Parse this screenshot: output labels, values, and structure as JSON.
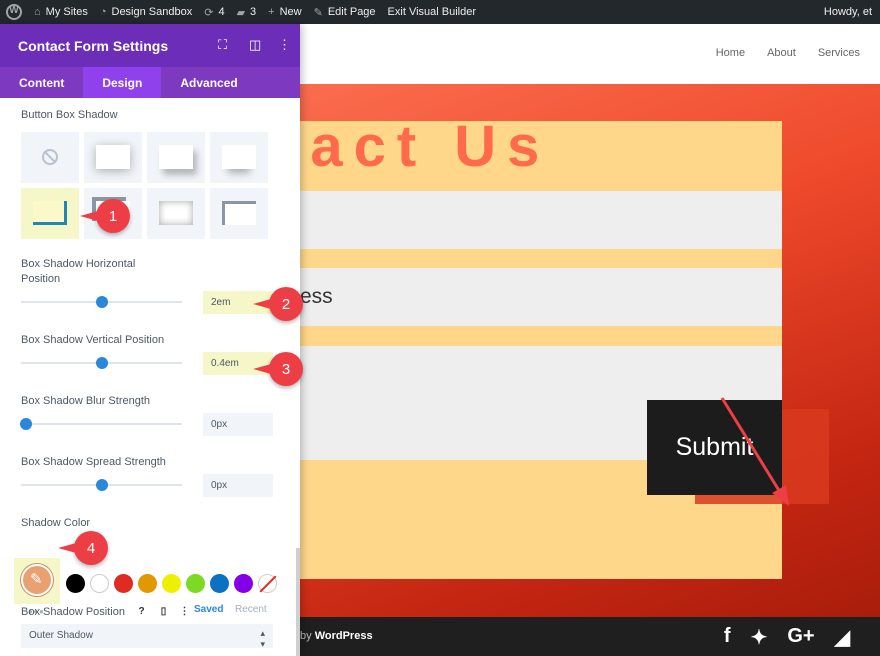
{
  "admin_bar": {
    "my_sites": "My Sites",
    "site_name": "Design Sandbox",
    "updates_count": "4",
    "comments_count": "3",
    "new_label": "New",
    "edit_page": "Edit Page",
    "exit_builder": "Exit Visual Builder",
    "howdy": "Howdy, et"
  },
  "site": {
    "nav": [
      "Home",
      "About",
      "Services"
    ],
    "page_heading": "tact Us",
    "email_placeholder_partial": "ess",
    "submit_label": "Submit",
    "footer_credit_prefix": "by",
    "footer_credit_brand": "WordPress",
    "social_icons": [
      "facebook-icon",
      "twitter-icon",
      "google-plus-icon",
      "rss-icon"
    ]
  },
  "panel": {
    "title": "Contact Form Settings",
    "tabs": [
      "Content",
      "Design",
      "Advanced"
    ],
    "active_tab": "Design",
    "box_shadow_label": "Button Box Shadow",
    "presets": [
      "none",
      "shadow-1",
      "shadow-2",
      "shadow-3",
      "shadow-4-selected",
      "shadow-5",
      "shadow-6",
      "shadow-7"
    ],
    "h_position_label": "Box Shadow Horizontal Position",
    "h_position_value": "2em",
    "h_position_slider_level": 0.5,
    "v_position_label": "Box Shadow Vertical Position",
    "v_position_value": "0.4em",
    "v_position_slider_level": 0.5,
    "blur_label": "Box Shadow Blur Strength",
    "blur_value": "0px",
    "blur_slider_level": 0.03,
    "spread_label": "Box Shadow Spread Strength",
    "spread_value": "0px",
    "spread_slider_level": 0.5,
    "color_label": "Shadow Color",
    "swatches": [
      "#000000",
      "#ffffff",
      "#e02b20",
      "#e09900",
      "#edf000",
      "#7cda24",
      "#0c71c3",
      "#8300e9",
      "none"
    ],
    "saved_tab": "Saved",
    "recent_tab": "Recent",
    "position_label": "Box Shadow Position",
    "help_icon_text": "?",
    "position_value": "Outer Shadow"
  },
  "callouts": [
    "1",
    "2",
    "3",
    "4"
  ],
  "colors": {
    "panel_header": "#6c2eb9",
    "panel_tabs": "#7d3ac1",
    "slider_thumb": "#2b87da",
    "badge": "#ee3e45",
    "highlight": "#f5f7c8"
  }
}
